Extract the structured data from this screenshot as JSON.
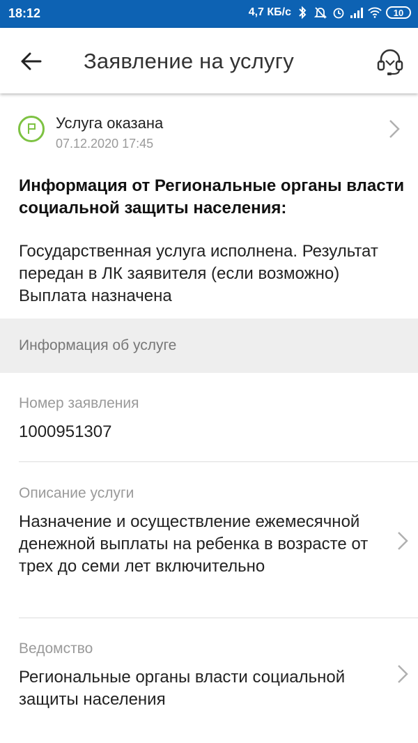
{
  "statusbar": {
    "time": "18:12",
    "network_speed": "4,7 КБ/с",
    "battery": "10"
  },
  "header": {
    "title": "Заявление на услугу"
  },
  "status": {
    "label": "Услуга оказана",
    "date": "07.12.2020 17:45"
  },
  "info": {
    "title": "Информация от Региональные органы власти социальной защиты населения:",
    "text": "Государственная услуга исполнена. Результат передан в ЛК заявителя (если возможно) Выплата назначена"
  },
  "section": {
    "title": "Информация об услуге"
  },
  "fields": {
    "application_number": {
      "label": "Номер заявления",
      "value": "1000951307"
    },
    "description": {
      "label": "Описание услуги",
      "value": "Назначение и осуществление ежемесячной денежной выплаты на ребенка в возрасте от трех до семи лет включительно"
    },
    "department": {
      "label": "Ведомство",
      "value": "Региональные органы власти социальной защиты населения"
    }
  },
  "colors": {
    "statusbar": "#0d62b3",
    "success": "#7dc242",
    "section_bg": "#eeeeee"
  }
}
